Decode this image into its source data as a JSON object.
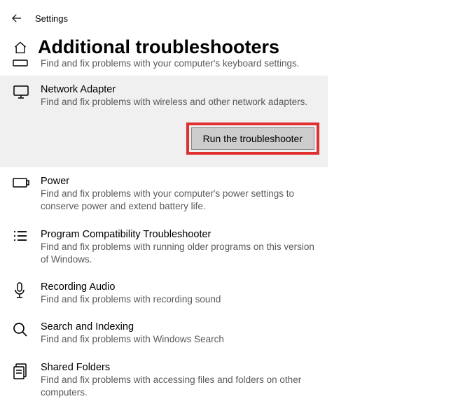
{
  "header": {
    "app": "Settings"
  },
  "page": {
    "title": "Additional troubleshooters"
  },
  "partial_item": {
    "desc": "Find and fix problems with your computer's keyboard settings."
  },
  "selected": {
    "label": "Network Adapter",
    "desc": "Find and fix problems with wireless and other network adapters.",
    "run_label": "Run the troubleshooter"
  },
  "items": [
    {
      "label": "Power",
      "desc": "Find and fix problems with your computer's power settings to conserve power and extend battery life."
    },
    {
      "label": "Program Compatibility Troubleshooter",
      "desc": "Find and fix problems with running older programs on this version of Windows."
    },
    {
      "label": "Recording Audio",
      "desc": "Find and fix problems with recording sound"
    },
    {
      "label": "Search and Indexing",
      "desc": "Find and fix problems with Windows Search"
    },
    {
      "label": "Shared Folders",
      "desc": "Find and fix problems with accessing files and folders on other computers."
    }
  ]
}
